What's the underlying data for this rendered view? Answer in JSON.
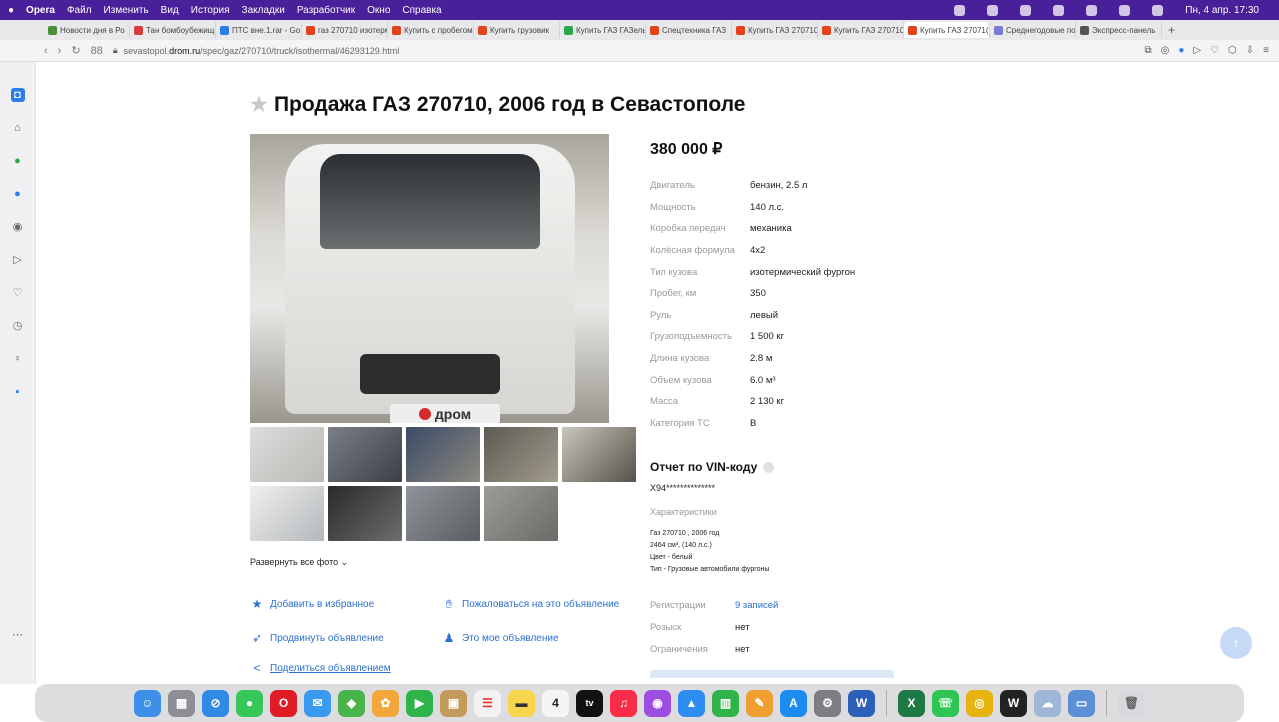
{
  "menubar": {
    "app": "Opera",
    "items": [
      "Файл",
      "Изменить",
      "Вид",
      "История",
      "Закладки",
      "Разработчик",
      "Окно",
      "Справка"
    ],
    "clock": "Пн, 4 апр.  17:30"
  },
  "tabs": [
    {
      "label": "Новости дня в Ро",
      "color": "#4a8f3c"
    },
    {
      "label": "Тан бомбоубежищ",
      "color": "#d83b3b"
    },
    {
      "label": "ПТС вне.1.rar - Go",
      "color": "#2b7de9"
    },
    {
      "label": "газ 270710 изотерм",
      "color": "#e2431b"
    },
    {
      "label": "Купить с пробегом",
      "color": "#e2431b"
    },
    {
      "label": "Купить грузовик",
      "color": "#e2431b"
    },
    {
      "label": "Купить ГАЗ ГАЗель",
      "color": "#2ba84a"
    },
    {
      "label": "Спецтехника ГАЗ",
      "color": "#e2431b"
    },
    {
      "label": "Купить ГАЗ 270710",
      "color": "#e2431b"
    },
    {
      "label": "Купить ГАЗ 270710",
      "color": "#e2431b"
    },
    {
      "label": "Купить ГАЗ 27071(",
      "color": "#e2431b"
    },
    {
      "label": "Среднегодовые по",
      "color": "#7a7ad6"
    },
    {
      "label": "Экспресс-панель",
      "color": "#555555"
    }
  ],
  "address": {
    "host_prefix": "sevastopol.",
    "host_bold": "drom.ru",
    "path": "/spec/gaz/270710/truck/isothermal/46293129.html",
    "speed_dial": "88"
  },
  "listing": {
    "title": "Продажа ГАЗ 270710, 2006 год в Севастополе",
    "price": "380 000 ₽",
    "photo_watermark": "дром",
    "expand_photos": "Развернуть все фото ⌄",
    "specs": [
      {
        "key": "Двигатель",
        "value": "бензин, 2.5 л"
      },
      {
        "key": "Мощность",
        "value": "140 л.с."
      },
      {
        "key": "Коробка передач",
        "value": "механика"
      },
      {
        "key": "Колёсная формула",
        "value": "4x2"
      },
      {
        "key": "Тип кузова",
        "value": "изотермический фургон"
      },
      {
        "key": "Пробег, км",
        "value": "350"
      },
      {
        "key": "Руль",
        "value": "левый"
      },
      {
        "key": "Грузоподъемность",
        "value": "1 500 кг"
      },
      {
        "key": "Длина кузова",
        "value": "2.8 м"
      },
      {
        "key": "Объем кузова",
        "value": "6.0 м³"
      },
      {
        "key": "Масса",
        "value": "2 130 кг"
      },
      {
        "key": "Категория ТС",
        "value": "B"
      }
    ],
    "actions": {
      "favorite": "Добавить в избранное",
      "report": "Пожаловаться на это объявление",
      "promote": "Продвинуть объявление",
      "mine": "Это мое объявление",
      "share": "Поделиться объявлением"
    }
  },
  "vin": {
    "title": "Отчет по VIN-коду",
    "masked": "X94**************",
    "char_title": "Характеристики",
    "char_lines": [
      "Газ 270710 , 2006 год",
      "2464 см³, (140 л.с.)",
      "Цвет - белый",
      "Тип - Грузовые автомобили фургоны"
    ],
    "registrations_key": "Регистрации",
    "registrations_val": "9 записей",
    "wanted_key": "Розыск",
    "wanted_val": "нет",
    "restrictions_key": "Ограничения",
    "restrictions_val": "нет"
  },
  "dock": {
    "calendar_day": "4",
    "tv_label": "tv"
  }
}
